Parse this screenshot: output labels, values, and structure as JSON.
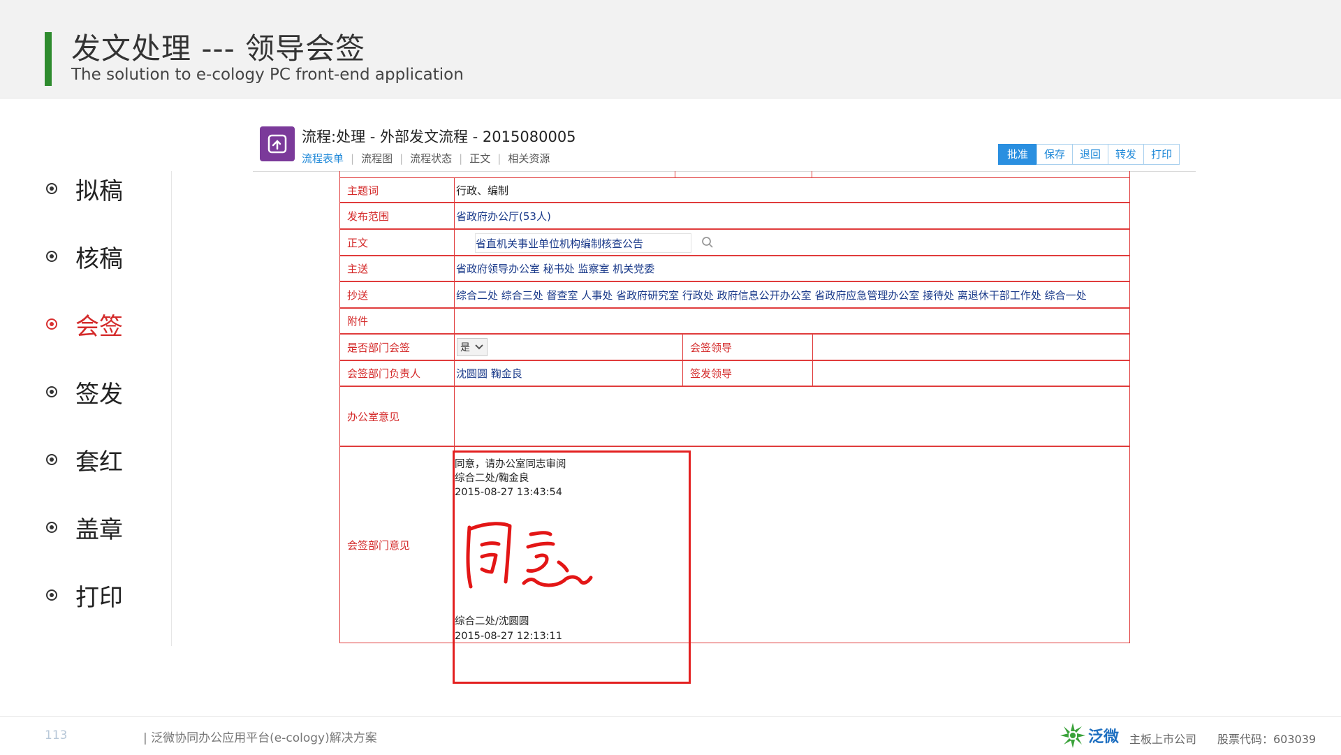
{
  "header": {
    "title": "发文处理 --- 领导会签",
    "subtitle": "The solution to e-cology PC front-end application"
  },
  "nav": {
    "items": [
      {
        "label": "拟稿",
        "active": false
      },
      {
        "label": "核稿",
        "active": false
      },
      {
        "label": "会签",
        "active": true
      },
      {
        "label": "签发",
        "active": false
      },
      {
        "label": "套红",
        "active": false
      },
      {
        "label": "盖章",
        "active": false
      },
      {
        "label": "打印",
        "active": false
      }
    ]
  },
  "app": {
    "title": "流程:处理 - 外部发文流程 - 2015080005",
    "tabs": [
      "流程表单",
      "流程图",
      "流程状态",
      "正文",
      "相关资源"
    ],
    "active_tab": "流程表单",
    "actions": [
      "批准",
      "保存",
      "退回",
      "转发",
      "打印"
    ]
  },
  "form": {
    "keywords": {
      "label": "主题词",
      "value": "行政、编制"
    },
    "scope": {
      "label": "发布范围",
      "value": "省政府办公厅(53人)"
    },
    "body": {
      "label": "正文",
      "value": "省直机关事业单位机构编制核查公告"
    },
    "main_send": {
      "label": "主送",
      "value": "省政府领导办公室 秘书处 监察室 机关党委"
    },
    "cc": {
      "label": "抄送",
      "value": "综合二处 综合三处 督查室 人事处 省政府研究室 行政处 政府信息公开办公室 省政府应急管理办公室 接待处 离退休干部工作处 综合一处"
    },
    "attachment": {
      "label": "附件",
      "value": ""
    },
    "dept_countersign": {
      "label": "是否部门会签",
      "value": "是"
    },
    "countersign_leader": {
      "label": "会签领导",
      "value": ""
    },
    "dept_head": {
      "label": "会签部门负责人",
      "value": "沈圆圆 鞠金良"
    },
    "issue_leader": {
      "label": "签发领导",
      "value": ""
    },
    "office_opinion": {
      "label": "办公室意见",
      "value": ""
    },
    "dept_opinion": {
      "label": "会签部门意见",
      "entry1": {
        "text": "同意，请办公室同志审阅",
        "signer": "综合二处/鞠金良",
        "time": "2015-08-27 13:43:54"
      },
      "entry2": {
        "signer": "综合二处/沈圆圆",
        "time": "2015-08-27 12:13:11"
      }
    }
  },
  "footer": {
    "page": "113",
    "desc": "| 泛微协同办公应用平台(e-cology)解决方案",
    "logo_text": "泛微",
    "company": "主板上市公司",
    "stock": "股票代码：603039"
  },
  "colors": {
    "accent_green": "#2e8b2e",
    "form_red": "#e03c3c",
    "link_blue": "#1e88d8"
  }
}
